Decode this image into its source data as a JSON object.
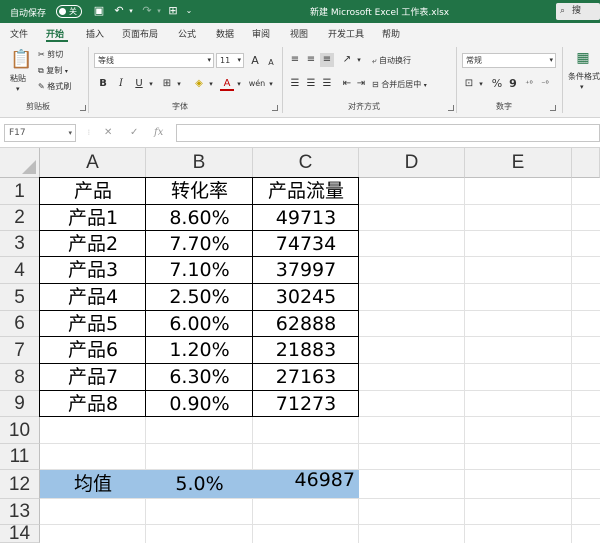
{
  "titlebar": {
    "autosave_label": "自动保存",
    "autosave_state": "关",
    "title": "新建 Microsoft Excel 工作表.xlsx",
    "search_placeholder": "搜"
  },
  "tabs": [
    "文件",
    "开始",
    "插入",
    "页面布局",
    "公式",
    "数据",
    "审阅",
    "视图",
    "开发工具",
    "帮助"
  ],
  "active_tab": "开始",
  "ribbon": {
    "clipboard": {
      "paste": "粘贴",
      "cut": "剪切",
      "copy": "复制",
      "format_painter": "格式刷",
      "label": "剪贴板"
    },
    "font": {
      "name": "等线",
      "size": "11",
      "label": "字体",
      "bold": "B",
      "italic": "I",
      "underline": "U",
      "grow": "A",
      "shrink": "A",
      "font_color": "A",
      "highlight": "◈",
      "pinyin": "wén"
    },
    "alignment": {
      "wrap": "自动换行",
      "merge": "合并后居中",
      "label": "对齐方式"
    },
    "number": {
      "format": "常规",
      "percent": "%",
      "comma": "9",
      "label": "数字"
    },
    "styles": {
      "conditional": "条件格式"
    }
  },
  "formula_bar": {
    "name_box": "F17",
    "cancel": "✕",
    "enter": "✓",
    "fx": "fx",
    "value": ""
  },
  "colors": {
    "brand": "#217346",
    "highlight": "#9dc3e6"
  },
  "columns": [
    "A",
    "B",
    "C",
    "D",
    "E"
  ],
  "rows": [
    "1",
    "2",
    "3",
    "4",
    "5",
    "6",
    "7",
    "8",
    "9",
    "10",
    "11",
    "12",
    "13",
    "14"
  ],
  "table": {
    "headers": [
      "产品",
      "转化率",
      "产品流量"
    ],
    "data": [
      [
        "产品1",
        "8.60%",
        "49713"
      ],
      [
        "产品2",
        "7.70%",
        "74734"
      ],
      [
        "产品3",
        "7.10%",
        "37997"
      ],
      [
        "产品4",
        "2.50%",
        "30245"
      ],
      [
        "产品5",
        "6.00%",
        "62888"
      ],
      [
        "产品6",
        "1.20%",
        "21883"
      ],
      [
        "产品7",
        "6.30%",
        "27163"
      ],
      [
        "产品8",
        "0.90%",
        "71273"
      ]
    ]
  },
  "average": {
    "label": "均值",
    "rate": "5.0%",
    "flow": "46987"
  }
}
